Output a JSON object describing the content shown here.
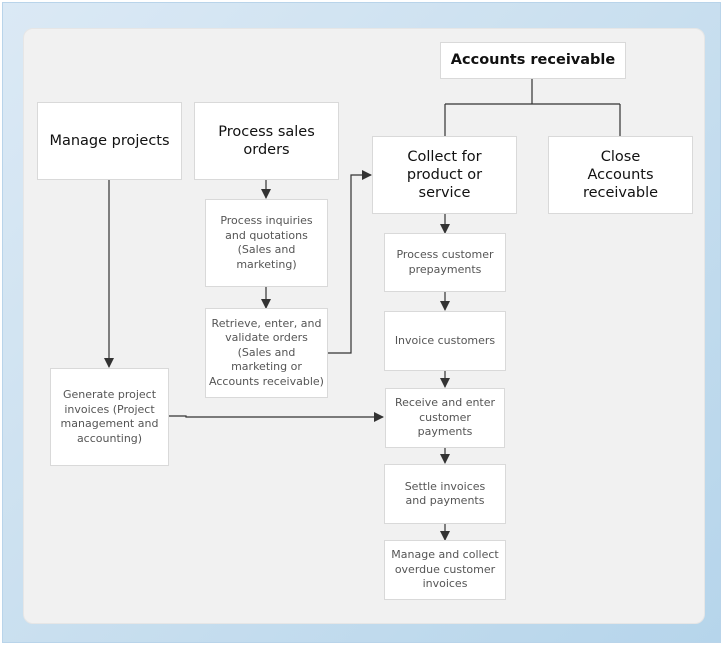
{
  "diagram": {
    "title": "Accounts receivable",
    "nodes": {
      "accounts_receivable": "Accounts receivable",
      "manage_projects": "Manage projects",
      "process_sales_orders": "Process sales orders",
      "collect_for_product": "Collect for product or service",
      "close_accounts_receivable": "Close Accounts receivable",
      "process_inquiries": "Process inquiries and quotations (Sales and marketing)",
      "retrieve_orders": "Retrieve, enter, and validate orders (Sales and marketing or Accounts receivable)",
      "generate_project_invoices": "Generate project invoices (Project management and accounting)",
      "process_prepayments": "Process customer prepayments",
      "invoice_customers": "Invoice customers",
      "receive_payments": "Receive and enter customer payments",
      "settle_invoices": "Settle invoices and payments",
      "manage_overdue": "Manage and collect overdue customer invoices"
    },
    "edges": [
      {
        "from": "accounts_receivable",
        "to": "collect_for_product",
        "arrow": false
      },
      {
        "from": "accounts_receivable",
        "to": "close_accounts_receivable",
        "arrow": false
      },
      {
        "from": "process_sales_orders",
        "to": "process_inquiries",
        "arrow": true
      },
      {
        "from": "process_inquiries",
        "to": "retrieve_orders",
        "arrow": true
      },
      {
        "from": "retrieve_orders",
        "to": "collect_for_product",
        "arrow": true
      },
      {
        "from": "manage_projects",
        "to": "generate_project_invoices",
        "arrow": true
      },
      {
        "from": "generate_project_invoices",
        "to": "receive_payments",
        "arrow": true
      },
      {
        "from": "collect_for_product",
        "to": "process_prepayments",
        "arrow": true
      },
      {
        "from": "process_prepayments",
        "to": "invoice_customers",
        "arrow": true
      },
      {
        "from": "invoice_customers",
        "to": "receive_payments",
        "arrow": true
      },
      {
        "from": "receive_payments",
        "to": "settle_invoices",
        "arrow": true
      },
      {
        "from": "settle_invoices",
        "to": "manage_overdue",
        "arrow": true
      }
    ],
    "colors": {
      "background_outer": "#c9dfef",
      "panel": "#f1f1f1",
      "box": "#ffffff",
      "box_border": "#d9d9d9",
      "connector": "#333333"
    }
  }
}
